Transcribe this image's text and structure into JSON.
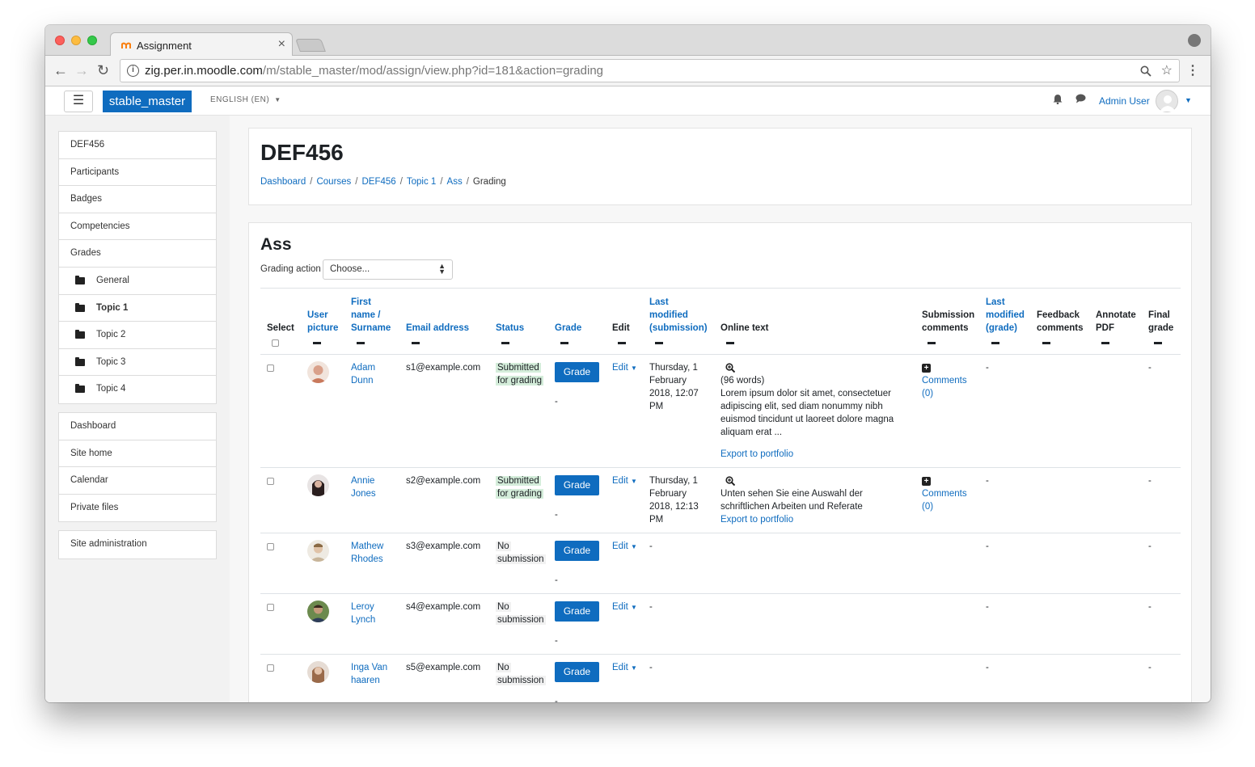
{
  "browser": {
    "tab_title": "Assignment",
    "tab_close": "×",
    "url_host": "zig.per.in.moodle.com",
    "url_path": "/m/stable_master/mod/assign/view.php?id=181&action=grading",
    "icons": {
      "back": "arrow-left-icon",
      "forward": "arrow-right-icon",
      "reload": "reload-icon",
      "info": "info-icon",
      "search": "search-icon",
      "star": "star-icon",
      "menu": "kebab-menu-icon",
      "profile": "profile-icon"
    }
  },
  "navbar": {
    "hamburger": "☰",
    "brand": "stable_master",
    "language": "ENGLISH (EN)",
    "user_name": "Admin User",
    "accent": "#0f6cbf"
  },
  "sidebar": {
    "group1": [
      {
        "label": "DEF456",
        "sub": false
      },
      {
        "label": "Participants",
        "sub": false
      },
      {
        "label": "Badges",
        "sub": false
      },
      {
        "label": "Competencies",
        "sub": false
      },
      {
        "label": "Grades",
        "sub": false
      },
      {
        "label": "General",
        "sub": true
      },
      {
        "label": "Topic 1",
        "sub": true,
        "active": true
      },
      {
        "label": "Topic 2",
        "sub": true
      },
      {
        "label": "Topic 3",
        "sub": true
      },
      {
        "label": "Topic 4",
        "sub": true
      }
    ],
    "group2": [
      {
        "label": "Dashboard"
      },
      {
        "label": "Site home"
      },
      {
        "label": "Calendar"
      },
      {
        "label": "Private files"
      }
    ],
    "group3": [
      {
        "label": "Site administration"
      }
    ]
  },
  "header": {
    "title": "DEF456",
    "breadcrumb": [
      "Dashboard",
      "Courses",
      "DEF456",
      "Topic 1",
      "Ass"
    ],
    "breadcrumb_current": "Grading",
    "separator": "/"
  },
  "assignment": {
    "title": "Ass",
    "grading_action_label": "Grading action",
    "grading_action_value": "Choose...",
    "columns": {
      "select": "Select",
      "user_picture": [
        "User",
        "picture"
      ],
      "name": [
        "First",
        "name /",
        "Surname"
      ],
      "email": "Email address",
      "status": "Status",
      "grade": "Grade",
      "edit": "Edit",
      "last_modified_sub": [
        "Last",
        "modified",
        "(submission)"
      ],
      "online_text": "Online text",
      "sub_comments": [
        "Submission",
        "comments"
      ],
      "last_modified_grade": [
        "Last",
        "modified",
        "(grade)"
      ],
      "feedback": [
        "Feedback",
        "comments"
      ],
      "annotate": [
        "Annotate",
        "PDF"
      ],
      "final_grade": [
        "Final",
        "grade"
      ]
    },
    "grade_button": "Grade",
    "edit_label": "Edit",
    "dash": "-",
    "rows": [
      {
        "first": "Adam",
        "last": "Dunn",
        "email": "s1@example.com",
        "status": [
          "Submitted",
          "for grading"
        ],
        "submitted": true,
        "modified": [
          "Thursday, 1",
          "February",
          "2018, 12:07",
          "PM"
        ],
        "words": "(96 words)",
        "text": [
          "Lorem ipsum dolor sit amet, consectetuer",
          "adipiscing elit, sed diam nonummy nibh",
          "euismod tincidunt ut laoreet dolore magna",
          "aliquam erat ..."
        ],
        "export": "Export to portfolio",
        "comments": [
          "Comments",
          "(0)"
        ],
        "avatar_color": "#d9a08a"
      },
      {
        "first": "Annie",
        "last": "Jones",
        "email": "s2@example.com",
        "status": [
          "Submitted",
          "for grading"
        ],
        "submitted": true,
        "modified": [
          "Thursday, 1",
          "February",
          "2018, 12:13",
          "PM"
        ],
        "words": "",
        "text": [
          "Unten sehen Sie eine Auswahl der",
          "schriftlichen Arbeiten und Referate"
        ],
        "export": "Export to portfolio",
        "comments": [
          "Comments",
          "(0)"
        ],
        "avatar_color": "#3a2a2a"
      },
      {
        "first": "Mathew",
        "last": "Rhodes",
        "email": "s3@example.com",
        "status": [
          "No",
          "submission"
        ],
        "submitted": false,
        "avatar_color": "#c8b59a"
      },
      {
        "first": "Leroy",
        "last": "Lynch",
        "email": "s4@example.com",
        "status": [
          "No",
          "submission"
        ],
        "submitted": false,
        "avatar_color": "#4f6b3a"
      },
      {
        "first": "Inga Van",
        "last": "haaren",
        "email": "s5@example.com",
        "status": [
          "No",
          "submission"
        ],
        "submitted": false,
        "avatar_color": "#b58a6e"
      }
    ]
  }
}
